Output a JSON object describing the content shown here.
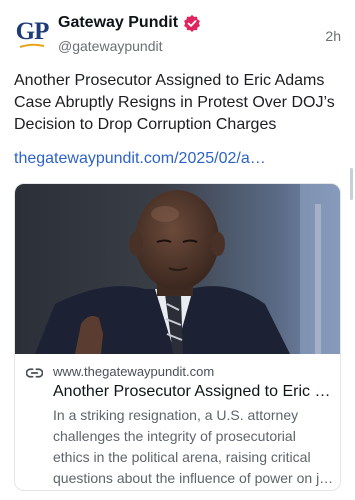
{
  "author": {
    "display_name": "Gateway Pundit",
    "handle": "@gatewaypundit",
    "avatar_text": "GP",
    "verified": true,
    "verified_color": "#e0245e"
  },
  "timestamp": "2h",
  "post": {
    "text": "Another Prosecutor Assigned to Eric Adams Case Abruptly Resigns in Protest Over DOJ’s Decision to Drop Corruption Charges",
    "link": "thegatewaypundit.com/2025/02/a…"
  },
  "link_card": {
    "domain": "www.thegatewaypundit.com",
    "title": "Another Prosecutor Assigned to Eric …",
    "description": "In a striking resignation, a U.S. attorney challenges the integrity of prosecutorial ethics in the political arena, raising critical questions about the influence of power on j…",
    "icon": "link-icon"
  },
  "colors": {
    "link": "#2e63c6",
    "secondary_text": "#6b6f74",
    "brand_blue": "#1f3b7a"
  }
}
